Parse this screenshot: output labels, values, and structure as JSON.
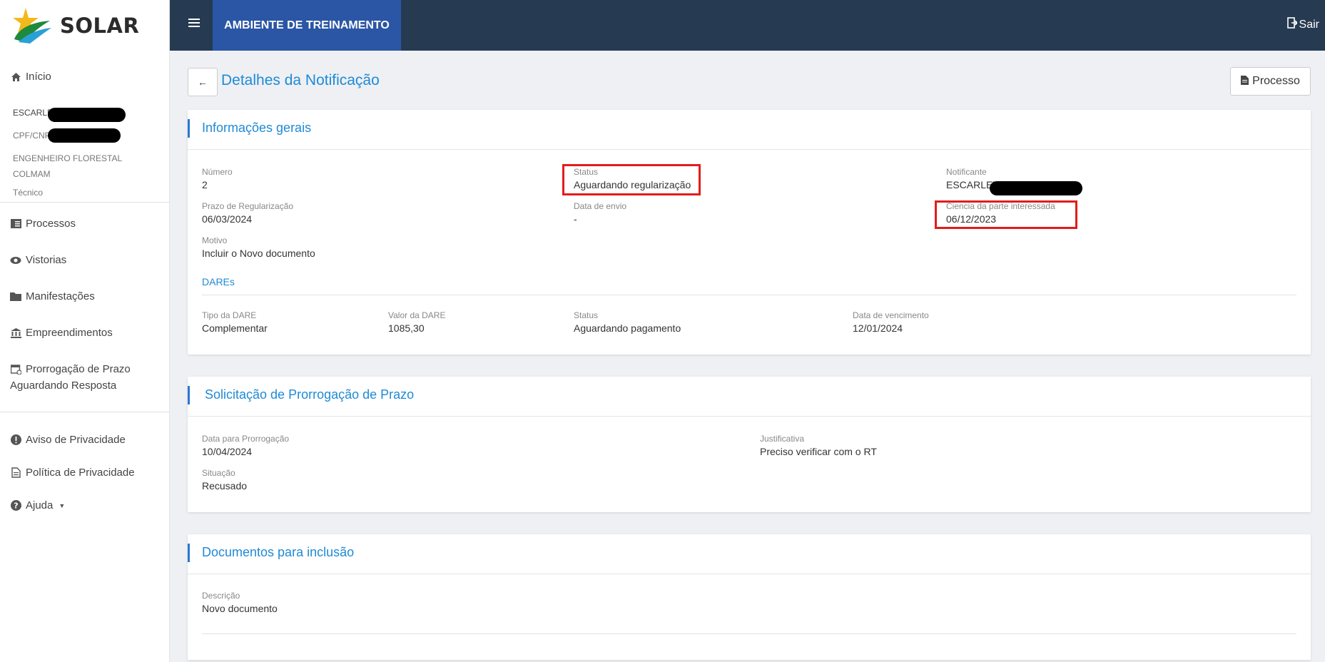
{
  "brand": {
    "name": "SOLAR"
  },
  "topbar": {
    "environment": "AMBIENTE DE TREINAMENTO",
    "logout": "Sair"
  },
  "sidebar": {
    "home": "Início",
    "user_name_prefix": "ESCARLE",
    "user_doc_prefix": "CPF/CNP",
    "role_line1": "ENGENHEIRO FLORESTAL",
    "role_line2": "COLMAM",
    "role_line3": "Técnico",
    "items": [
      {
        "label": "Processos",
        "icon": "list-icon"
      },
      {
        "label": "Vistorias",
        "icon": "eye-icon"
      },
      {
        "label": "Manifestações",
        "icon": "folder-icon"
      },
      {
        "label": "Empreendimentos",
        "icon": "bank-icon"
      },
      {
        "label": "Prorrogação de Prazo",
        "label2": "Aguardando Resposta",
        "icon": "calendar-icon"
      }
    ],
    "footer_items": [
      {
        "label": "Aviso de Privacidade",
        "icon": "alert-icon"
      },
      {
        "label": "Política de Privacidade",
        "icon": "document-icon"
      },
      {
        "label": "Ajuda",
        "icon": "help-icon"
      }
    ]
  },
  "page": {
    "title": "Detalhes da Notificação",
    "process_button": "Processo"
  },
  "general": {
    "title": "Informações gerais",
    "numero_label": "Número",
    "numero": "2",
    "status_label": "Status",
    "status": "Aguardando regularização",
    "notificante_label": "Notificante",
    "notificante_prefix": "ESCARLET",
    "prazo_label": "Prazo de Regularização",
    "prazo": "06/03/2024",
    "envio_label": "Data de envio",
    "envio": "-",
    "ciencia_label": "Ciencia da parte interessada",
    "ciencia": "06/12/2023",
    "motivo_label": "Motivo",
    "motivo": "Incluir o Novo documento",
    "dares_title": "DAREs",
    "dare": {
      "tipo_label": "Tipo da DARE",
      "tipo": "Complementar",
      "valor_label": "Valor da DARE",
      "valor": "1085,30",
      "status_label": "Status",
      "status": "Aguardando pagamento",
      "venc_label": "Data de vencimento",
      "venc": "12/01/2024"
    }
  },
  "extension": {
    "title": "Solicitação de Prorrogação de Prazo",
    "data_label": "Data para Prorrogação",
    "data": "10/04/2024",
    "justificativa_label": "Justificativa",
    "justificativa": "Preciso verificar com o RT",
    "situacao_label": "Situação",
    "situacao": "Recusado"
  },
  "documents": {
    "title": "Documentos para inclusão",
    "descricao_label": "Descrição",
    "descricao": "Novo documento"
  },
  "colors": {
    "topbar": "#263b52",
    "env_bg": "#2b56a5",
    "accent": "#1f8ad6",
    "highlight": "#e31c1c"
  }
}
